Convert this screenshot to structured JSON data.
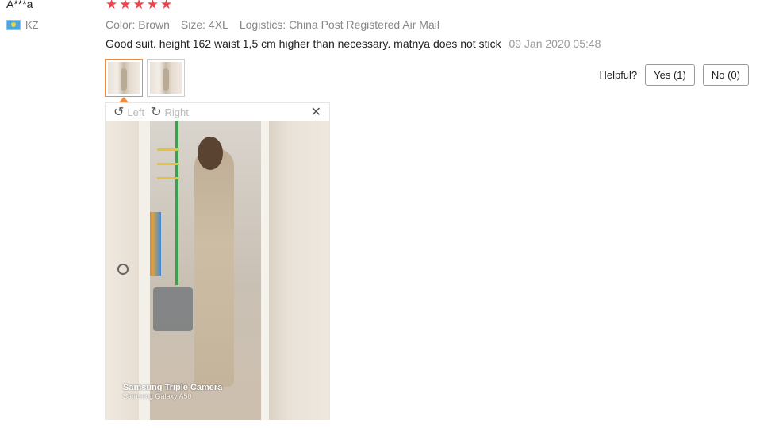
{
  "reviewer": {
    "name": "A***a",
    "country_code": "KZ",
    "flag_icon": "kazakhstan-flag-icon"
  },
  "rating": {
    "stars": 5,
    "max": 5,
    "star_glyph": "★",
    "color": "#e8464e"
  },
  "order_meta": {
    "color": "Color: Brown",
    "size": "Size: 4XL",
    "logistics": "Logistics: China Post Registered Air Mail"
  },
  "review": {
    "text": "Good suit. height 162 waist 1,5 cm higher than necessary. matnya does not stick",
    "date": "09 Jan 2020 05:48"
  },
  "helpful": {
    "label": "Helpful?",
    "yes_label": "Yes (1)",
    "no_label": "No (0)"
  },
  "viewer": {
    "rotate_left_label": "Left",
    "rotate_right_label": "Right",
    "rotate_left_icon": "↺",
    "rotate_right_icon": "↻",
    "close_icon": "✕",
    "watermark_line1": "Samsung Triple Camera",
    "watermark_line2": "Samsung Galaxy A50"
  },
  "colors": {
    "accent": "#f08a3e",
    "star": "#e8464e",
    "muted_text": "#888888"
  }
}
